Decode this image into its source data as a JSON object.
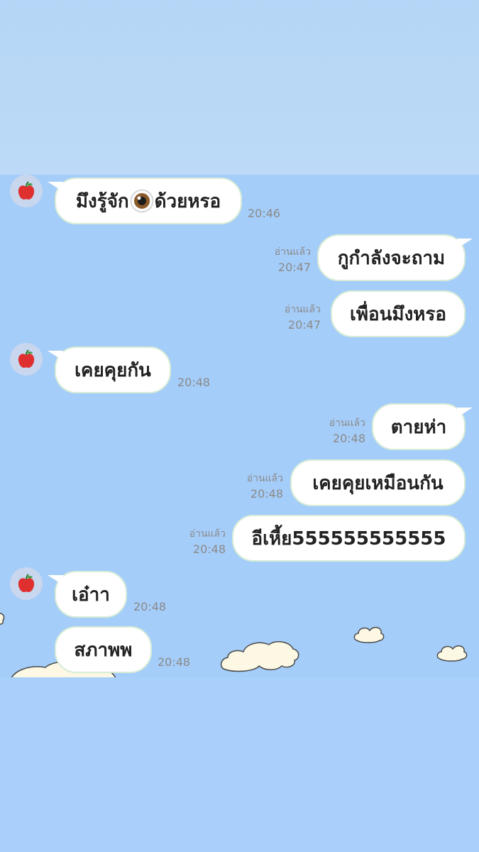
{
  "chat": {
    "read_label": "อ่านแล้ว",
    "messages": [
      {
        "side": "in",
        "text_before": "มึงรู้จัก",
        "text_after": "ด้วยหรอ",
        "icon": "eye-emoji-icon",
        "time": "20:46"
      },
      {
        "side": "out",
        "text": "กูกำลังจะถาม",
        "read": "อ่านแล้ว",
        "time": "20:47"
      },
      {
        "side": "out",
        "text": "เพื่อนมึงหรอ",
        "read": "อ่านแล้ว",
        "time": "20:47"
      },
      {
        "side": "in",
        "text": "เคยคุยกัน",
        "time": "20:48"
      },
      {
        "side": "out",
        "text": "ตายห่า",
        "read": "อ่านแล้ว",
        "time": "20:48"
      },
      {
        "side": "out",
        "text": "เคยคุยเหมือนกัน",
        "read": "อ่านแล้ว",
        "time": "20:48"
      },
      {
        "side": "out",
        "text": "อีเหี้ย555555555555",
        "read": "อ่านแล้ว",
        "time": "20:48"
      },
      {
        "side": "in",
        "text": "เอ๋าา",
        "time": "20:48"
      },
      {
        "side": "in",
        "text": "สภาพพ",
        "time": "20:48"
      }
    ]
  },
  "avatar_icon": "apple-icon",
  "colors": {
    "chat_background": "#a5cdf9",
    "bubble": "#ffffff",
    "bubble_border": "#d7ecd6",
    "timestamp": "#8a8a8a",
    "text": "#222222"
  }
}
